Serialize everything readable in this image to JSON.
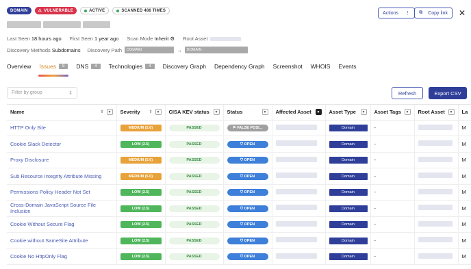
{
  "header": {
    "badges": [
      "DOMAIN",
      "VULNERABLE",
      "ACTIVE",
      "SCANNED 486 TIMES"
    ],
    "actions_label": "Actions",
    "copy_link_label": "Copy link"
  },
  "meta": {
    "last_seen_label": "Last Seen",
    "last_seen_value": "18 hours ago",
    "first_seen_label": "First Seen",
    "first_seen_value": "1 year ago",
    "scan_mode_label": "Scan Mode",
    "scan_mode_value": "Inherit",
    "root_asset_label": "Root Asset",
    "discovery_methods_label": "Discovery Methods",
    "discovery_methods_value": "Subdomains",
    "discovery_path_label": "Discovery Path",
    "path_chip_1": "DOMAIN:",
    "path_chip_2": "DOMAIN:",
    "path_arrow": "→"
  },
  "tabs": [
    {
      "label": "Overview"
    },
    {
      "label": "Issues",
      "count": "9"
    },
    {
      "label": "DNS",
      "count": "4"
    },
    {
      "label": "Technologies",
      "count": "4"
    },
    {
      "label": "Discovery Graph"
    },
    {
      "label": "Dependency Graph"
    },
    {
      "label": "Screenshot"
    },
    {
      "label": "WHOIS"
    },
    {
      "label": "Events"
    }
  ],
  "toolbar": {
    "filter_placeholder": "Filter by group",
    "refresh_label": "Refresh",
    "export_label": "Export CSV"
  },
  "table": {
    "columns": [
      "Name",
      "Severity",
      "CISA KEV status",
      "Status",
      "Affected Asset",
      "Asset Type",
      "Asset Tags",
      "Root Asset",
      "La"
    ],
    "rows": [
      {
        "name": "HTTP Only Site",
        "severity": "MEDIUM (5.0)",
        "sev_class": "medium",
        "kev": "PASSED",
        "status": "FALSE POSI...",
        "status_class": "fp",
        "asset_type": "Domain",
        "tags": "-",
        "last": "M"
      },
      {
        "name": "Cookie Slack Detector",
        "severity": "LOW (2.5)",
        "sev_class": "low",
        "kev": "PASSED",
        "status": "OPEN",
        "status_class": "open",
        "asset_type": "Domain",
        "tags": "-",
        "last": "M"
      },
      {
        "name": "Proxy Disclosure",
        "severity": "MEDIUM (5.0)",
        "sev_class": "medium",
        "kev": "PASSED",
        "status": "OPEN",
        "status_class": "open",
        "asset_type": "Domain",
        "tags": "-",
        "last": "M"
      },
      {
        "name": "Sub Resource Integrity Attribute Missing",
        "severity": "MEDIUM (5.0)",
        "sev_class": "medium",
        "kev": "PASSED",
        "status": "OPEN",
        "status_class": "open",
        "asset_type": "Domain",
        "tags": "-",
        "last": "M"
      },
      {
        "name": "Permissions Policy Header Not Set",
        "severity": "LOW (2.5)",
        "sev_class": "low",
        "kev": "PASSED",
        "status": "OPEN",
        "status_class": "open",
        "asset_type": "Domain",
        "tags": "-",
        "last": "M"
      },
      {
        "name": "Cross-Domain JavaScript Source File Inclusion",
        "severity": "LOW (2.5)",
        "sev_class": "low",
        "kev": "PASSED",
        "status": "OPEN",
        "status_class": "open",
        "asset_type": "Domain",
        "tags": "-",
        "last": "M"
      },
      {
        "name": "Cookie Without Secure Flag",
        "severity": "LOW (2.5)",
        "sev_class": "low",
        "kev": "PASSED",
        "status": "OPEN",
        "status_class": "open",
        "asset_type": "Domain",
        "tags": "-",
        "last": "M"
      },
      {
        "name": "Cookie without SameSite Attribute",
        "severity": "LOW (2.5)",
        "sev_class": "low",
        "kev": "PASSED",
        "status": "OPEN",
        "status_class": "open",
        "asset_type": "Domain",
        "tags": "-",
        "last": "M"
      },
      {
        "name": "Cookie No HttpOnly Flag",
        "severity": "LOW (2.5)",
        "sev_class": "low",
        "kev": "PASSED",
        "status": "OPEN",
        "status_class": "open",
        "asset_type": "Domain",
        "tags": "-",
        "last": "M"
      }
    ]
  },
  "icons": {
    "warning": "warning-icon",
    "kebab": "kebab-menu-icon",
    "copy": "copy-icon",
    "close": "close-icon",
    "gear": "gear-icon",
    "filter": "filter-icon",
    "sort": "sort-icon",
    "shield": "shield-icon",
    "flag": "flag-icon"
  }
}
